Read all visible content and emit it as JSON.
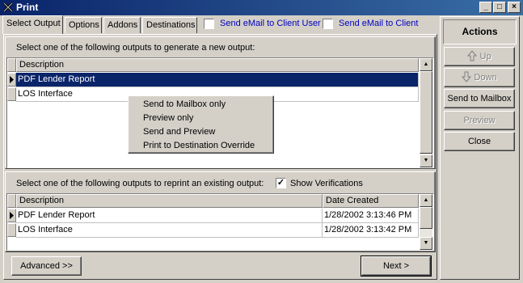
{
  "window": {
    "title": "Print",
    "controls": {
      "minimize": "_",
      "maximize": "□",
      "close": "×"
    }
  },
  "tabs": [
    {
      "label": "Select Output",
      "active": true
    },
    {
      "label": "Options",
      "active": false
    },
    {
      "label": "Addons",
      "active": false
    },
    {
      "label": "Destinations",
      "active": false
    }
  ],
  "email_options": {
    "user": {
      "label": "Send eMail to Client User",
      "checked": false
    },
    "client": {
      "label": "Send eMail to Client",
      "checked": false
    }
  },
  "new_output": {
    "prompt": "Select one of the following outputs to generate a new output:",
    "header": "Description",
    "rows": [
      {
        "description": "PDF Lender Report",
        "selected": true
      },
      {
        "description": "LOS Interface",
        "selected": false
      }
    ]
  },
  "context_menu": {
    "items": [
      "Send to Mailbox only",
      "Preview only",
      "Send and Preview",
      "Print to Destination Override"
    ]
  },
  "reprint": {
    "prompt": "Select one of the following outputs to reprint an existing output:",
    "show_verifications": {
      "label": "Show Verifications",
      "checked": true
    },
    "headers": {
      "description": "Description",
      "date": "Date Created"
    },
    "rows": [
      {
        "description": "PDF Lender Report",
        "date": "1/28/2002 3:13:46 PM"
      },
      {
        "description": "LOS Interface",
        "date": "1/28/2002 3:13:42 PM"
      }
    ]
  },
  "buttons": {
    "advanced": "Advanced >>",
    "next": "Next  >"
  },
  "actions": {
    "title": "Actions",
    "up": "Up",
    "down": "Down",
    "send_to_mailbox": "Send to Mailbox",
    "preview": "Preview",
    "close": "Close"
  },
  "colors": {
    "window_bg": "#d4d0c8",
    "selection": "#0a246a",
    "link": "#0000c0"
  }
}
